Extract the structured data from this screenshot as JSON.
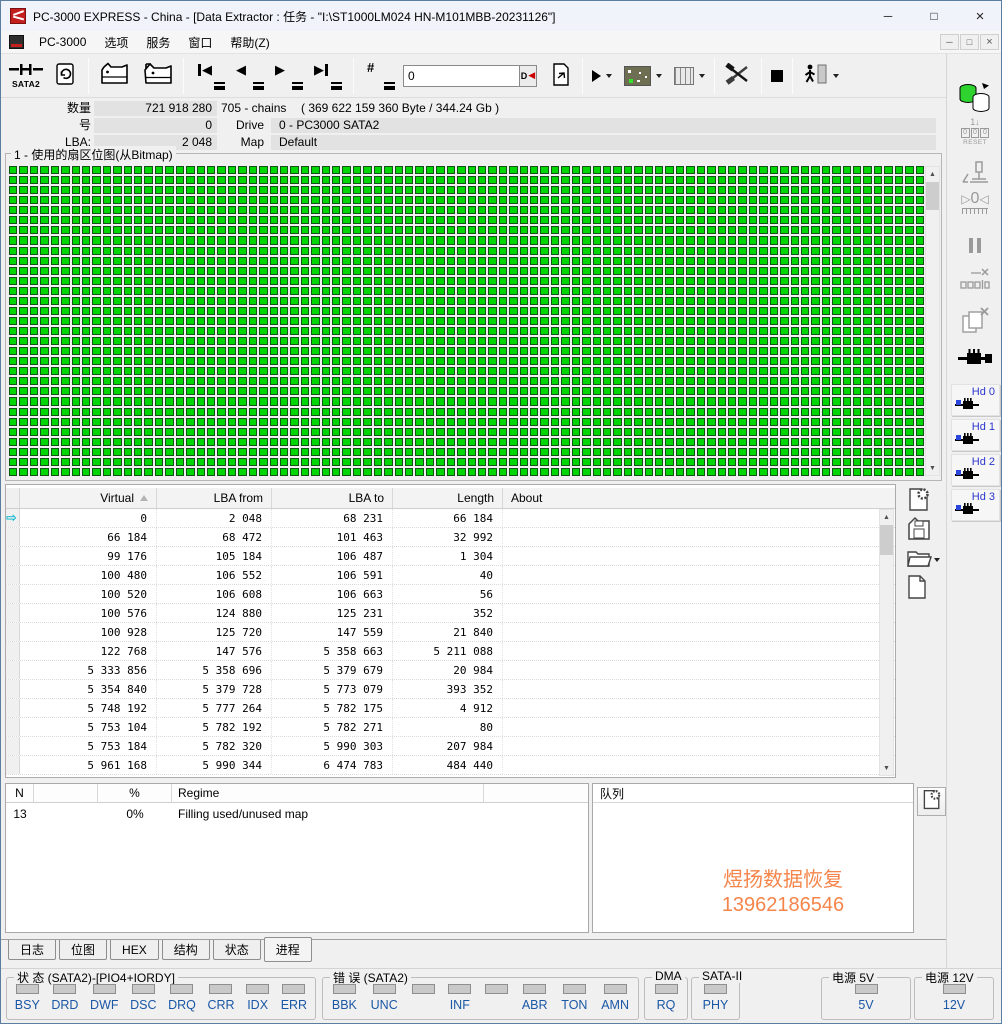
{
  "window": {
    "title": "PC-3000 EXPRESS - China - [Data Extractor : 任务 - \"I:\\ST1000LM024 HN-M101MBB-20231126\"]",
    "minimize": "─",
    "maximize": "□",
    "close": "×"
  },
  "menu": {
    "items": [
      "PC-3000",
      "选项",
      "服务",
      "窗口",
      "帮助(Z)"
    ],
    "mdi": [
      "─",
      "□",
      "×"
    ]
  },
  "toolbar": {
    "sata2_label": "SATA2",
    "sector_value": "0",
    "d_label": "D"
  },
  "info": {
    "qty_label": "数量",
    "qty_value": "721 918 280",
    "chains_text": "705 - chains",
    "size_text": "( 369 622 159 360 Byte /  344.24 Gb )",
    "num_label": "号",
    "num_value": "0",
    "drive_label": "Drive",
    "drive_value": "0 - PC3000 SATA2",
    "lba_label": "LBA:",
    "lba_value": "2 048",
    "map_label": "Map",
    "map_value": "Default"
  },
  "bitmap": {
    "title": "1 - 使用的扇区位图(从Bitmap)",
    "cols": 88,
    "rows": 31,
    "cell_color": "#00d602"
  },
  "chains": {
    "headers": [
      "Virtual",
      "LBA from",
      "LBA to",
      "Length",
      "About"
    ],
    "sorted_column": "Virtual",
    "rows": [
      [
        "0",
        "2 048",
        "68 231",
        "66 184",
        ""
      ],
      [
        "66 184",
        "68 472",
        "101 463",
        "32 992",
        ""
      ],
      [
        "99 176",
        "105 184",
        "106 487",
        "1 304",
        ""
      ],
      [
        "100 480",
        "106 552",
        "106 591",
        "40",
        ""
      ],
      [
        "100 520",
        "106 608",
        "106 663",
        "56",
        ""
      ],
      [
        "100 576",
        "124 880",
        "125 231",
        "352",
        ""
      ],
      [
        "100 928",
        "125 720",
        "147 559",
        "21 840",
        ""
      ],
      [
        "122 768",
        "147 576",
        "5 358 663",
        "5 211 088",
        ""
      ],
      [
        "5 333 856",
        "5 358 696",
        "5 379 679",
        "20 984",
        ""
      ],
      [
        "5 354 840",
        "5 379 728",
        "5 773 079",
        "393 352",
        ""
      ],
      [
        "5 748 192",
        "5 777 264",
        "5 782 175",
        "4 912",
        ""
      ],
      [
        "5 753 104",
        "5 782 192",
        "5 782 271",
        "80",
        ""
      ],
      [
        "5 753 184",
        "5 782 320",
        "5 990 303",
        "207 984",
        ""
      ],
      [
        "5 961 168",
        "5 990 344",
        "6 474 783",
        "484 440",
        ""
      ]
    ]
  },
  "processes": {
    "headers": [
      "N",
      "",
      "%",
      "Regime",
      ""
    ],
    "rows": [
      [
        "13",
        "",
        "0%",
        "Filling used/unused map",
        ""
      ]
    ],
    "queue_label": "队列",
    "watermark": {
      "line1": "煜扬数据恢复",
      "line2": "13962186546",
      "color": "#f5854a"
    }
  },
  "tabs": {
    "items": [
      "日志",
      "位图",
      "HEX",
      "结构",
      "状态",
      "进程"
    ],
    "active": "进程"
  },
  "status_bar": {
    "label_color": "#1a57a5",
    "groups": [
      {
        "title": "状 态 (SATA2)-[PIO4+IORDY]",
        "leds": [
          "BSY",
          "DRD",
          "DWF",
          "DSC",
          "DRQ",
          "CRR",
          "IDX",
          "ERR"
        ]
      },
      {
        "title": "错 误 (SATA2)",
        "leds": [
          "BBK",
          "UNC",
          "",
          "INF",
          "",
          "ABR",
          "TON",
          "AMN"
        ]
      },
      {
        "title": "DMA",
        "leds": [
          "RQ"
        ]
      },
      {
        "title": "SATA-II",
        "leds": [
          "PHY"
        ]
      },
      {
        "title": "电源 5V",
        "leds": [
          "5V"
        ]
      },
      {
        "title": "电源 12V",
        "leds": [
          "12V"
        ]
      }
    ]
  },
  "right_sidebar": {
    "reset_label": "RESET",
    "hd_buttons": [
      "Hd 0",
      "Hd 1",
      "Hd 2",
      "Hd 3"
    ]
  }
}
